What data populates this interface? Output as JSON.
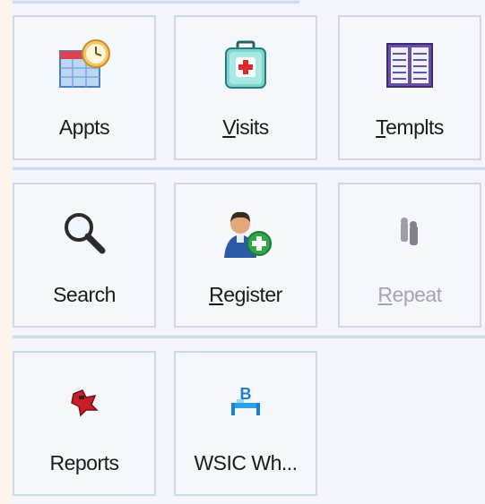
{
  "tiles": [
    {
      "label": "Appts",
      "mnemonic": "",
      "rest": "Appts",
      "icon": "calendar-clock-icon",
      "enabled": true
    },
    {
      "label": "Visits",
      "mnemonic": "V",
      "rest": "isits",
      "icon": "first-aid-kit-icon",
      "enabled": true
    },
    {
      "label": "Templts",
      "mnemonic": "T",
      "rest": "emplts",
      "icon": "template-book-icon",
      "enabled": true
    },
    {
      "label": "Search",
      "mnemonic": "",
      "rest": "Search",
      "icon": "magnifier-icon",
      "enabled": true
    },
    {
      "label": "Register",
      "mnemonic": "R",
      "rest": "egister",
      "icon": "add-person-icon",
      "enabled": true
    },
    {
      "label": "Repeat",
      "mnemonic": "R",
      "rest": "epeat",
      "icon": "repeat-people-icon",
      "enabled": false
    },
    {
      "label": "Reports",
      "mnemonic": "",
      "rest": "Reports",
      "icon": "reports-icon",
      "enabled": true
    },
    {
      "label": "WSIC Wh...",
      "mnemonic": "",
      "rest": "WSIC Wh...",
      "icon": "bed-icon",
      "enabled": true
    }
  ],
  "colors": {
    "background": "#fdf3ec",
    "panel": "#f2f5fb",
    "tile_border": "#cdd7e6",
    "disabled_text": "#a2a6ad"
  }
}
